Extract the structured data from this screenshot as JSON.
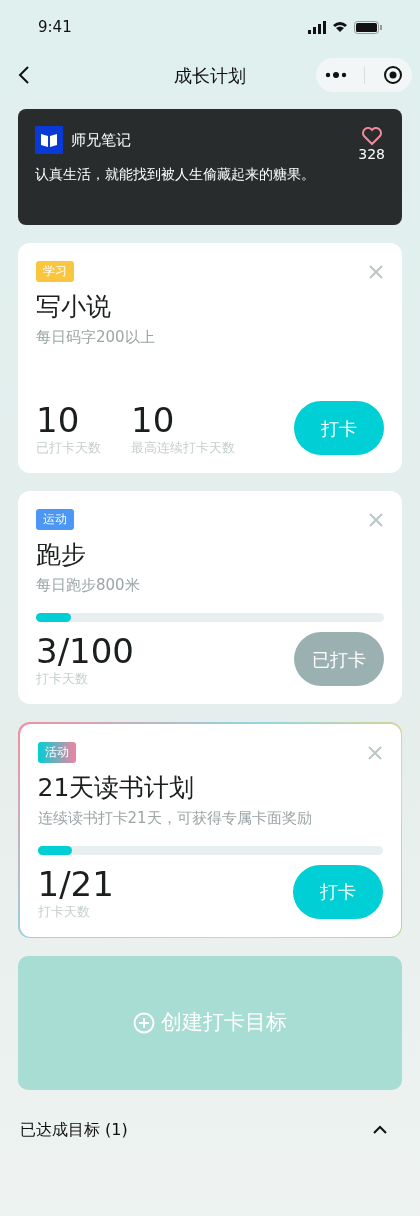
{
  "status_bar": {
    "time": "9:41"
  },
  "nav": {
    "title": "成长计划"
  },
  "banner": {
    "author": "师兄笔记",
    "likes": "328",
    "quote": "认真生活，就能找到被人生偷藏起来的糖果。"
  },
  "goals": [
    {
      "kind": "normal",
      "tag": {
        "label": "学习",
        "color": "#fbc63f"
      },
      "title": "写小说",
      "desc": "每日码字200以上",
      "stats": [
        {
          "value": "10",
          "label": "已打卡天数"
        },
        {
          "value": "10",
          "label": "最高连续打卡天数"
        }
      ],
      "button": "打卡",
      "checked_in": false
    },
    {
      "kind": "normal",
      "tag": {
        "label": "运动",
        "color": "#4c97f5"
      },
      "title": "跑步",
      "desc": "每日跑步800米",
      "level": 0.1,
      "stats": [
        {
          "value": "3/100",
          "label": "打卡天数"
        }
      ],
      "button": "已打卡",
      "checked_in": true
    },
    {
      "kind": "activity",
      "tag": {
        "label": "活动"
      },
      "title": "21天读书计划",
      "desc": "连续读书打卡21天，可获得专属卡面奖励",
      "level": 0.1,
      "stats": [
        {
          "value": "1/21",
          "label": "打卡天数"
        }
      ],
      "button": "打卡",
      "checked_in": false
    }
  ],
  "create_button": "创建打卡目标",
  "achieved": {
    "label": "已达成目标 (1)",
    "expanded": true
  }
}
